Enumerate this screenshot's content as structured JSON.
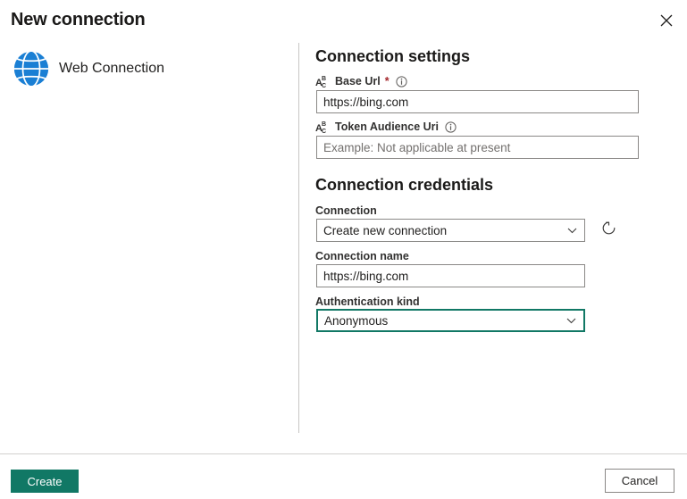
{
  "dialog": {
    "title": "New connection",
    "close_icon": "close-icon"
  },
  "connector": {
    "label": "Web Connection",
    "icon": "globe-icon"
  },
  "settings": {
    "heading": "Connection settings",
    "fields": [
      {
        "label": "Base Url",
        "required_marker": "*",
        "type_icon": "abc-text-icon",
        "info_icon": "info-icon",
        "value": "https://bing.com",
        "placeholder": ""
      },
      {
        "label": "Token Audience Uri",
        "required_marker": "",
        "type_icon": "abc-text-icon",
        "info_icon": "info-icon",
        "value": "",
        "placeholder": "Example: Not applicable at present"
      }
    ]
  },
  "credentials": {
    "heading": "Connection credentials",
    "connection": {
      "label": "Connection",
      "value": "Create new connection",
      "chevron_icon": "chevron-down-icon"
    },
    "refresh": {
      "icon": "refresh-icon"
    },
    "connection_name": {
      "label": "Connection name",
      "value": "https://bing.com",
      "placeholder": ""
    },
    "authentication_kind": {
      "label": "Authentication kind",
      "value": "Anonymous",
      "chevron_icon": "chevron-down-icon"
    }
  },
  "footer": {
    "create_label": "Create",
    "cancel_label": "Cancel"
  },
  "colors": {
    "accent": "#117865",
    "brand_blue": "#1a7fd4",
    "required": "#a4262c",
    "border": "#8a8886",
    "divider": "#c8c6c4"
  }
}
